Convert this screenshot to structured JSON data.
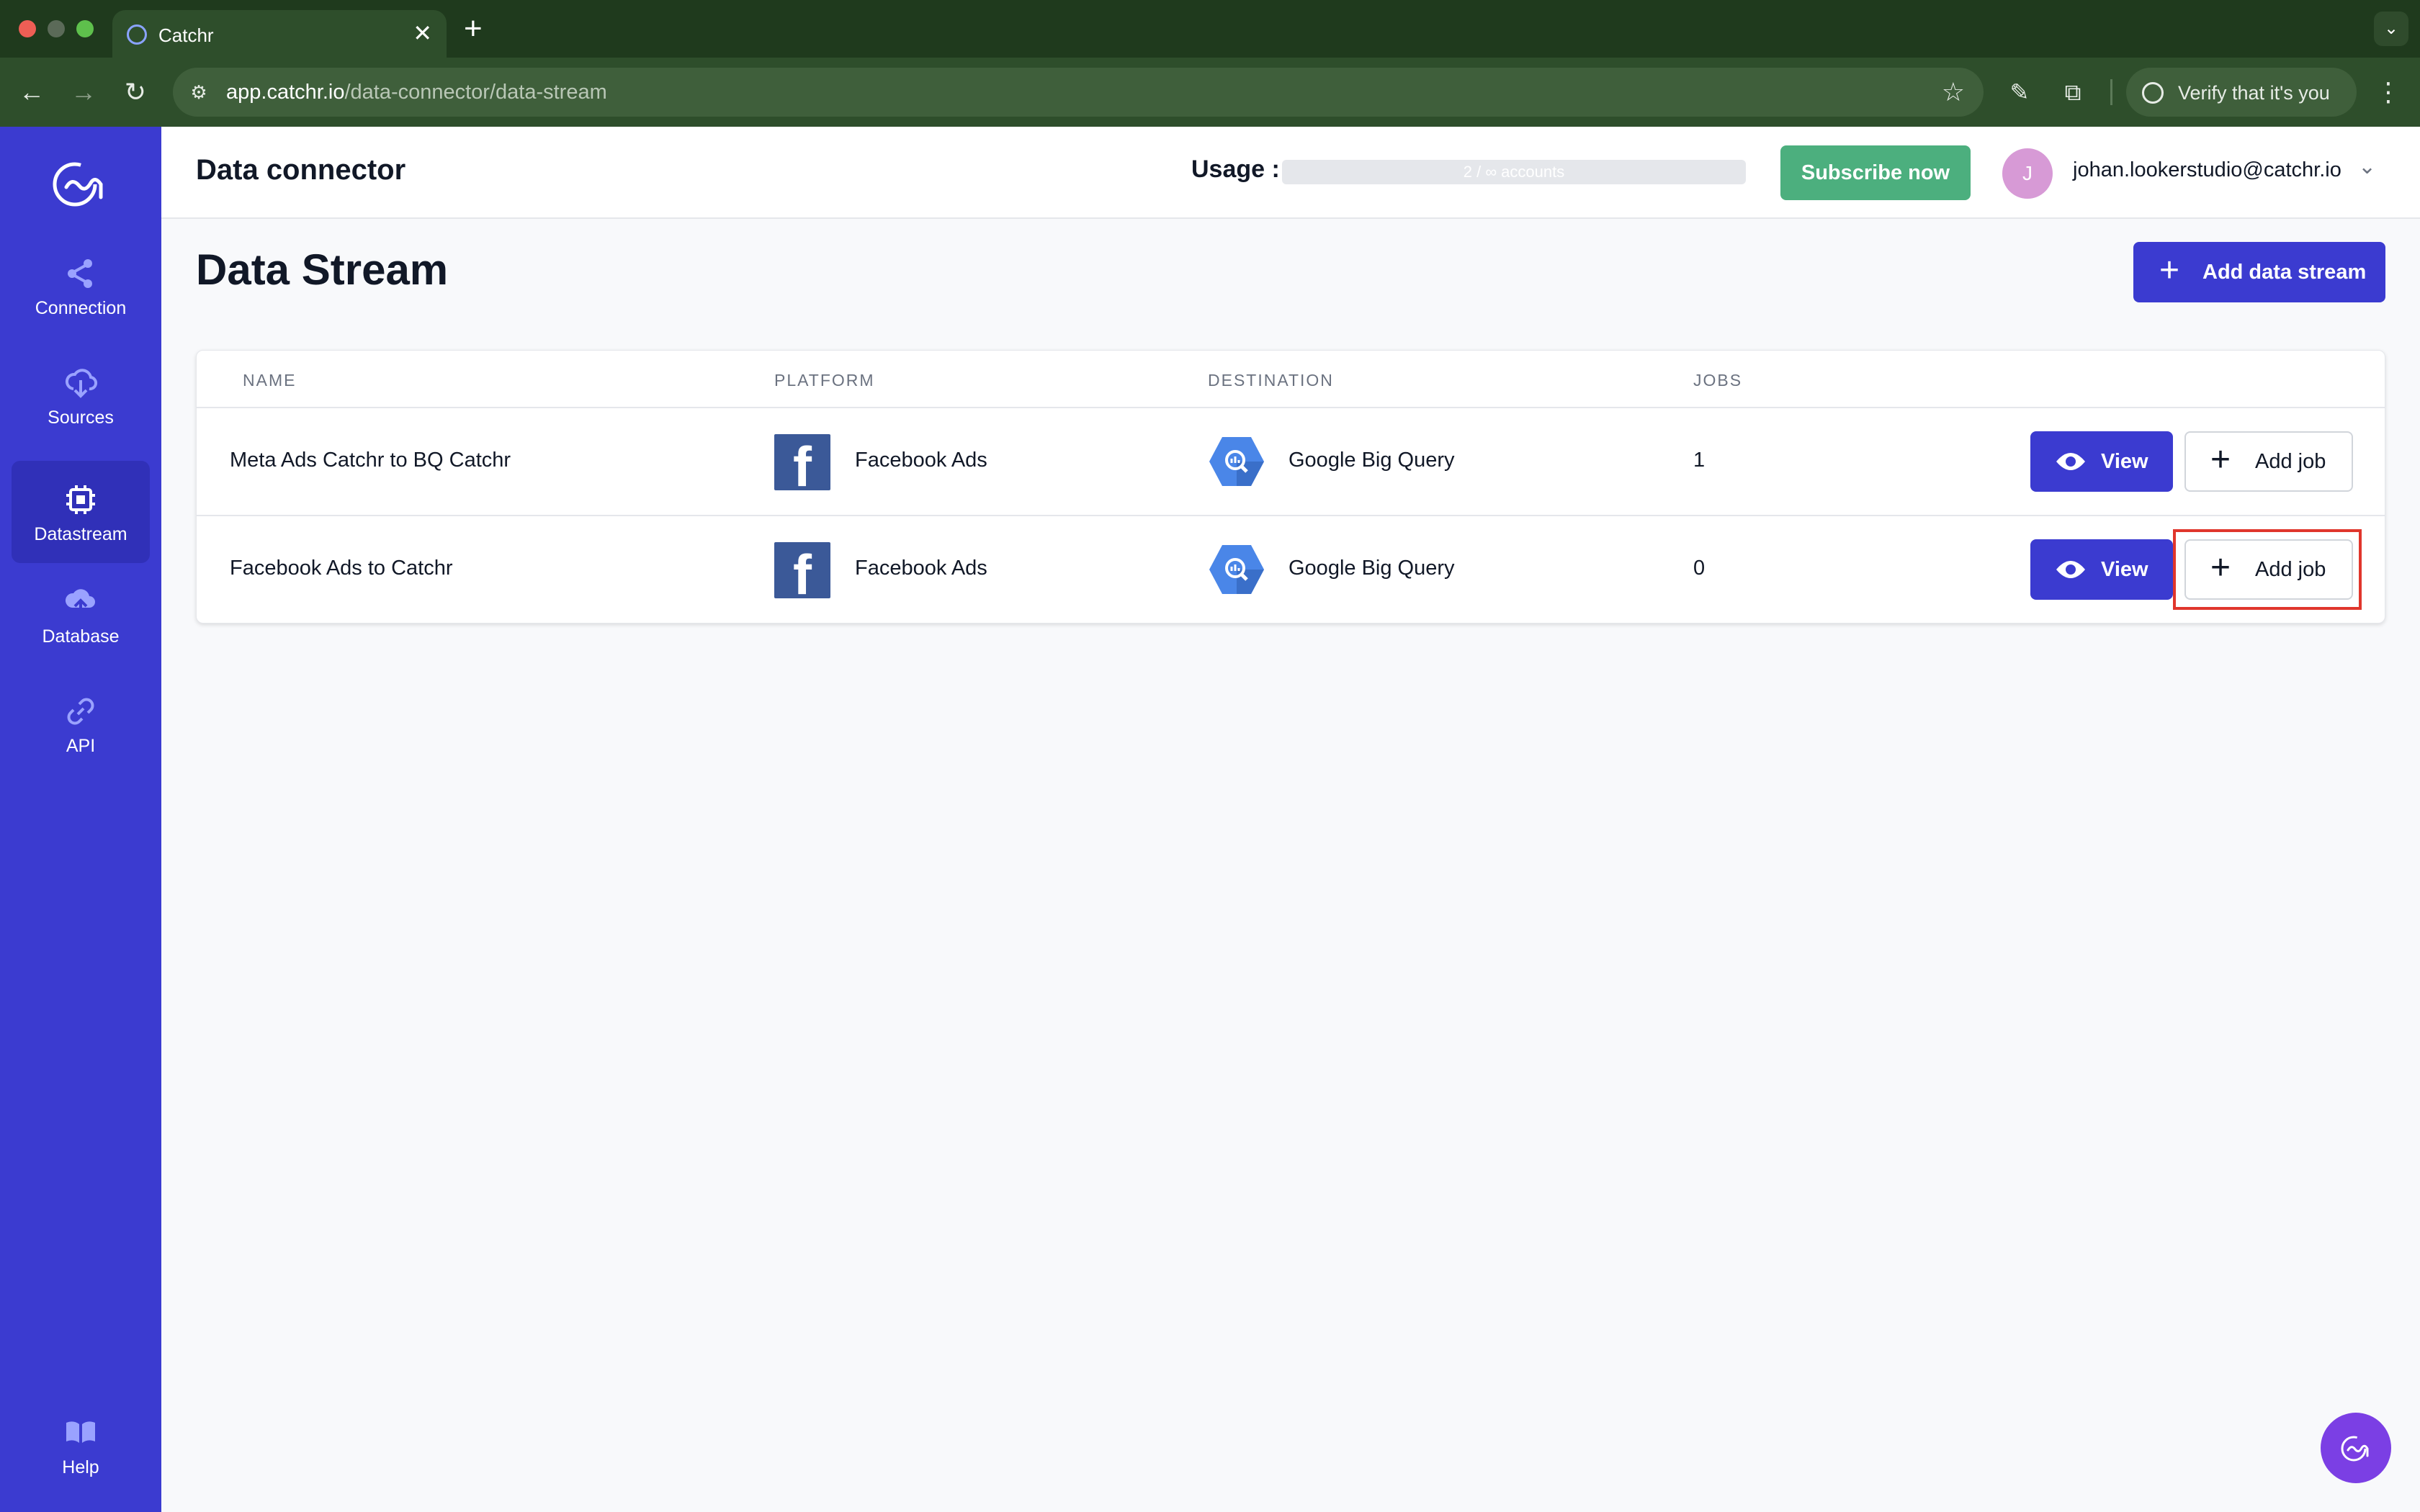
{
  "browser": {
    "tab_title": "Catchr",
    "tab_close": "✕",
    "new_tab": "+",
    "url_host": "app.catchr.io",
    "url_path": "/data-connector/data-stream",
    "verify_label": "Verify that it's you"
  },
  "sidebar": {
    "items": [
      {
        "label": "Connection",
        "icon": "share-icon"
      },
      {
        "label": "Sources",
        "icon": "cloud-download-icon"
      },
      {
        "label": "Datastream",
        "icon": "chip-icon",
        "active": true
      },
      {
        "label": "Database",
        "icon": "cloud-upload-icon"
      },
      {
        "label": "API",
        "icon": "link-icon"
      },
      {
        "label": "Help",
        "icon": "book-icon"
      }
    ]
  },
  "header": {
    "title": "Data connector",
    "usage_label": "Usage :",
    "usage_text": "2 / ∞ accounts",
    "subscribe_label": "Subscribe now",
    "avatar_initial": "J",
    "user_email": "johan.lookerstudio@catchr.io"
  },
  "main": {
    "page_title": "Data Stream",
    "add_stream_label": "Add data stream",
    "table": {
      "headers": {
        "name": "NAME",
        "platform": "PLATFORM",
        "destination": "DESTINATION",
        "jobs": "JOBS"
      },
      "rows": [
        {
          "name": "Meta Ads Catchr to BQ Catchr",
          "platform": "Facebook Ads",
          "destination": "Google Big Query",
          "jobs": "1",
          "view_label": "View",
          "add_job_label": "Add job"
        },
        {
          "name": "Facebook Ads to Catchr",
          "platform": "Facebook Ads",
          "destination": "Google Big Query",
          "jobs": "0",
          "view_label": "View",
          "add_job_label": "Add job"
        }
      ]
    }
  },
  "colors": {
    "sidebar": "#3b3bd0",
    "primary": "#3b3bd0",
    "subscribe": "#4caf7e",
    "highlight": "#e0362c",
    "facebook": "#3b5998",
    "bigquery": "#4a86e8"
  }
}
